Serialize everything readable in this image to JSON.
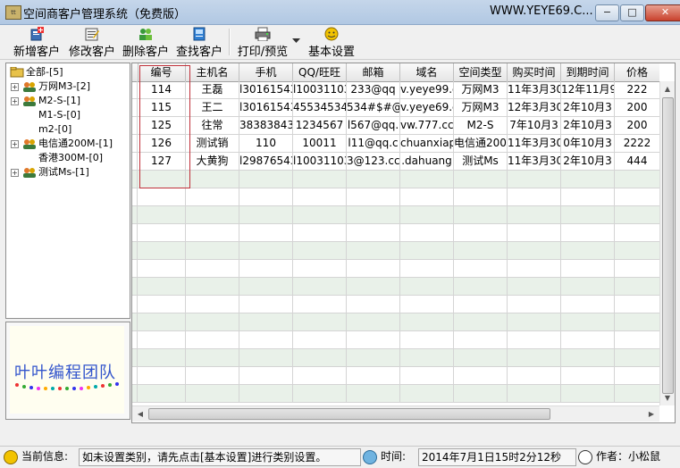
{
  "window": {
    "title": "空间商客户管理系统（免费版）",
    "website": "WWW.YEYE69.C...",
    "app_icon_text": "tt",
    "minimize": "−",
    "maximize": "□",
    "close": "✕"
  },
  "toolbar": {
    "items": [
      {
        "label": "新增客户",
        "icon": "add-customer-icon"
      },
      {
        "label": "修改客户",
        "icon": "edit-customer-icon"
      },
      {
        "label": "删除客户",
        "icon": "delete-customer-icon"
      },
      {
        "label": "查找客户",
        "icon": "find-customer-icon"
      },
      {
        "label": "打印/预览",
        "icon": "print-icon"
      },
      {
        "label": "基本设置",
        "icon": "settings-icon"
      }
    ]
  },
  "tree": {
    "items": [
      {
        "label": "全部-[5]",
        "expander": ""
      },
      {
        "label": "万网M3-[2]",
        "expander": "+"
      },
      {
        "label": "M2-S-[1]",
        "expander": "+"
      },
      {
        "label": "M1-S-[0]",
        "expander": ""
      },
      {
        "label": "m2-[0]",
        "expander": ""
      },
      {
        "label": "电信通200M-[1]",
        "expander": "+"
      },
      {
        "label": "香港300M-[0]",
        "expander": ""
      },
      {
        "label": "测试Ms-[1]",
        "expander": "+"
      }
    ]
  },
  "logo": {
    "text": "叶叶编程团队"
  },
  "grid": {
    "columns": [
      "编号",
      "主机名",
      "手机",
      "QQ/旺旺",
      "邮箱",
      "域名",
      "空间类型",
      "购买时间",
      "到期时间",
      "价格"
    ],
    "rows": [
      [
        "114",
        "王磊",
        "l30161543",
        "l10031103",
        "233@qq",
        "v.yeye99.c",
        "万网M3",
        "11年3月30",
        "12年11月9",
        "222"
      ],
      [
        "115",
        "王二",
        "l30161543",
        "45534534",
        "534#$#@",
        "v.yeye69.c",
        "万网M3",
        "12年3月30",
        "2年10月3",
        "200"
      ],
      [
        "125",
        "往常",
        "38383843",
        "1234567",
        "l567@qq.",
        "vw.777.cc",
        "M2-S",
        "7年10月3",
        "2年10月3",
        "200"
      ],
      [
        "126",
        "测试销",
        "110",
        "10011",
        "l11@qq.c",
        "chuanxiap",
        "电信通200M",
        "11年3月30",
        "0年10月3",
        "2222"
      ],
      [
        "127",
        "大黄狗",
        "l29876543",
        "l10031103",
        "3@123.cc",
        ".dahuang",
        "测试Ms",
        "11年3月30",
        "2年10月3",
        "444"
      ]
    ]
  },
  "status": {
    "info_label": "当前信息:",
    "info_text": "如未设置类别，请先点击[基本设置]进行类别设置。",
    "time_label": "时间:",
    "time_value": "2014年7月1日15时2分12秒",
    "author": "作者：小松鼠"
  },
  "colors": {
    "titlebar": "#b8cde6",
    "selection_box": "#c0303a",
    "row_alt": "#e9f1e9"
  }
}
